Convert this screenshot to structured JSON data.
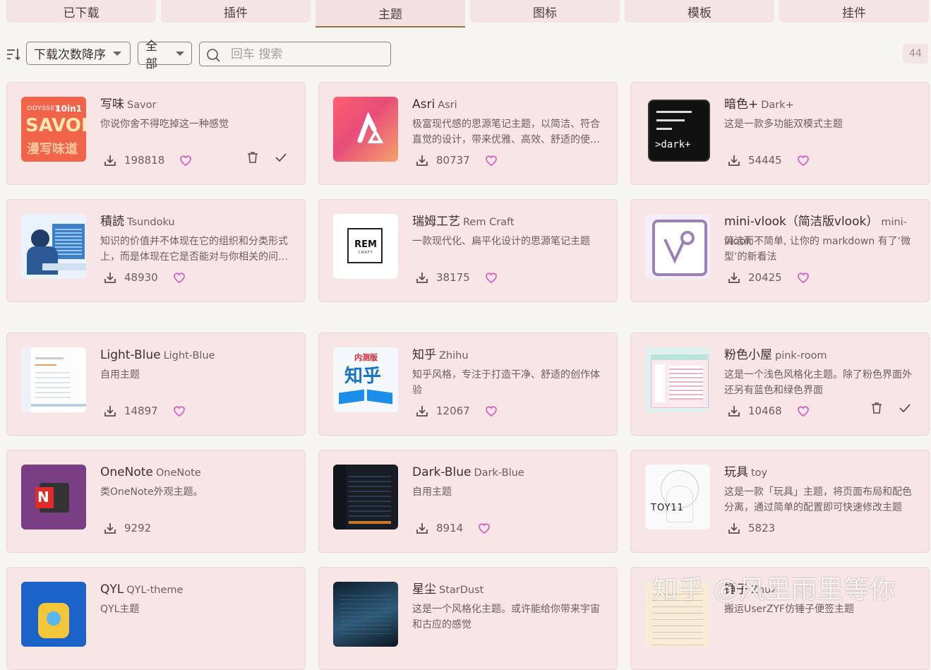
{
  "tabs": [
    "已下载",
    "插件",
    "主题",
    "图标",
    "模板",
    "挂件"
  ],
  "active_tab": "主题",
  "toolbar": {
    "sort_select": "下载次数降序",
    "filter_select": "全部",
    "search_placeholder": "回车 搜索",
    "count": "44"
  },
  "cards": [
    {
      "title": "写味",
      "subtitle": "Savor",
      "desc": "你说你舍不得吃掉这一种感觉",
      "downloads": "198818",
      "installed": true,
      "thumb_text": "SAVOR",
      "thumb_badge": "10in1",
      "thumb_top": "ODYSSEY",
      "thumb_cn": "漫写味道"
    },
    {
      "title": "Asri",
      "subtitle": "Asri",
      "desc": "极富现代感的思源笔记主题，以简洁、符合直觉的设计，带来优雅、高效、舒适的使用体验",
      "downloads": "80737",
      "installed": false
    },
    {
      "title": "暗色+",
      "subtitle": "Dark+",
      "desc": "这是一款多功能双模式主题",
      "downloads": "54445",
      "installed": false,
      "thumb_text": ">dark+"
    },
    {
      "title": "積読",
      "subtitle": "Tsundoku",
      "desc": "知识的价值并不体现在它的组织和分类形式上，而是体现在它是否能对与你相关的问题做出贡献",
      "downloads": "48930",
      "installed": false
    },
    {
      "title": "瑞姆工艺",
      "subtitle": "Rem Craft",
      "desc": "一款现代化、扁平化设计的思源笔记主题",
      "downloads": "38175",
      "installed": false,
      "thumb_text": "REM",
      "thumb_small": "CRAFT"
    },
    {
      "title": "mini-vlook（简洁版vlook）",
      "subtitle": "mini-vlook",
      "desc": "简洁而不简单, 让你的 markdown 有了‘微型’的新看法",
      "downloads": "20425",
      "installed": false
    },
    {
      "title": "Light-Blue",
      "subtitle": "Light-Blue",
      "desc": "自用主题",
      "downloads": "14897",
      "installed": false
    },
    {
      "title": "知乎",
      "subtitle": "Zhihu",
      "desc": "知乎风格，专注于打造干净、舒适的创作体验",
      "downloads": "12067",
      "installed": false,
      "thumb_text": "知乎",
      "thumb_badge": "内测版"
    },
    {
      "title": "粉色小屋",
      "subtitle": "pink-room",
      "desc": "这是一个浅色风格化主题。除了粉色界面外还另有蓝色和绿色界面",
      "downloads": "10468",
      "installed": true
    },
    {
      "title": "OneNote",
      "subtitle": "OneNote",
      "desc": "类OneNote外观主题。",
      "downloads": "9292",
      "installed": false,
      "no_heart": true,
      "thumb_text": "N"
    },
    {
      "title": "Dark-Blue",
      "subtitle": "Dark-Blue",
      "desc": "自用主题",
      "downloads": "8914",
      "installed": false
    },
    {
      "title": "玩具",
      "subtitle": "toy",
      "desc": "这是一款「玩具」主题，将页面布局和配色分离，通过简单的配置即可快速修改主题",
      "downloads": "5823",
      "installed": false,
      "no_heart": true,
      "thumb_text": "TOY11"
    },
    {
      "title": "QYL",
      "subtitle": "QYL-theme",
      "desc": "QYL主题",
      "downloads": "",
      "installed": false
    },
    {
      "title": "星尘",
      "subtitle": "StarDust",
      "desc": "这是一个风格化主题。或许能给你带来宇宙和古应的感觉",
      "downloads": "",
      "installed": false
    },
    {
      "title": "锤子",
      "subtitle": "Zhuzi",
      "desc": "搬运UserZYF仿锤子便签主题",
      "downloads": "",
      "installed": false
    }
  ],
  "watermark": "知乎 @风里雨里等你",
  "colors": {
    "card_bg": "#f8e6e6",
    "heart": "#d45ac4",
    "accent_underline": "#8a7a3a"
  }
}
